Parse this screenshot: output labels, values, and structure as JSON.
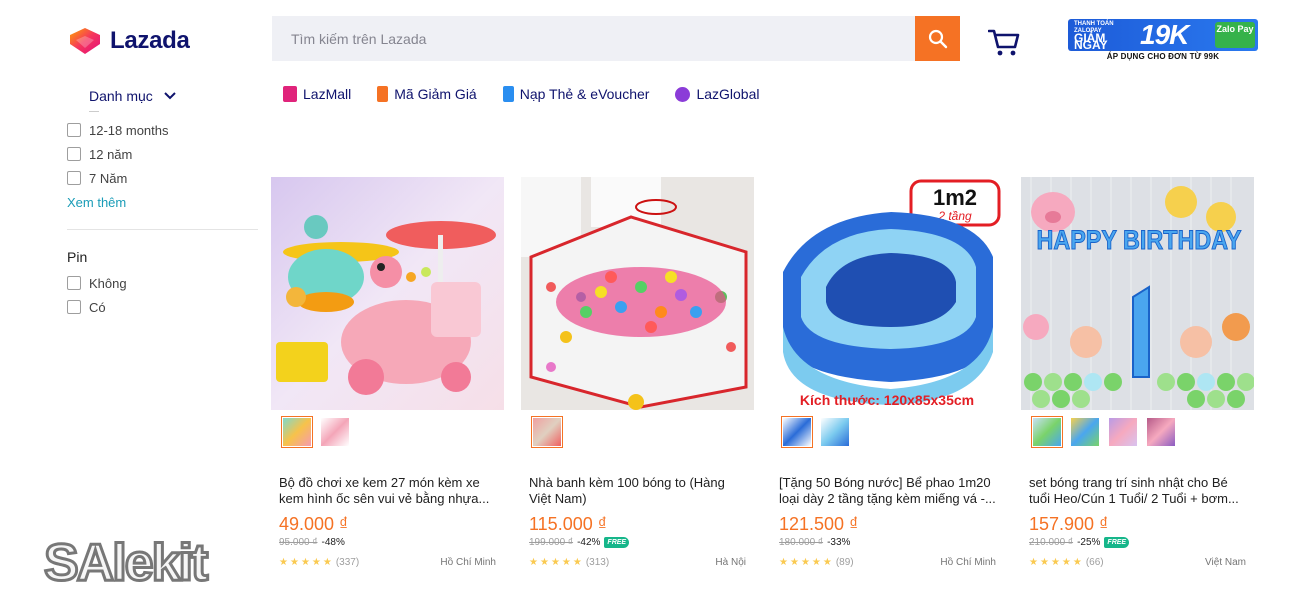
{
  "header": {
    "logo_text": "Lazada",
    "search_placeholder": "Tìm kiếm trên Lazada",
    "promo": {
      "line1": "THANH TOÁN ZALOPAY",
      "line2": "GIẢM NGAY",
      "amount": "19K",
      "badge": "Zalo Pay",
      "bottom": "ÁP DỤNG CHO ĐƠN TỪ 99K"
    }
  },
  "category_label": "Danh mục",
  "topnav": [
    {
      "label": "LazMall",
      "color": "#e0247b"
    },
    {
      "label": "Mã Giảm Giá",
      "color": "#f57224"
    },
    {
      "label": "Nạp Thẻ & eVoucher",
      "color": "#2a8ef0"
    },
    {
      "label": "LazGlobal",
      "color": "#8b3cd8"
    }
  ],
  "filters": {
    "age_options": [
      "12-18 months",
      "12 năm",
      "7 Năm"
    ],
    "see_more": "Xem thêm",
    "battery_title": "Pin",
    "battery_options": [
      "Không",
      "Có"
    ]
  },
  "products": [
    {
      "title": "Bộ đồ chơi xe kem 27 món kèm xe kem hình ốc sên vui vẻ bằng nhựa...",
      "price": "49.000 ₫",
      "original_price": "95.000 ₫",
      "discount": "-48%",
      "free_shipping": false,
      "rating_count": "(337)",
      "location": "Hồ Chí Minh"
    },
    {
      "title": "Nhà banh kèm 100 bóng to (Hàng Việt Nam)",
      "price": "115.000 ₫",
      "original_price": "199.000 ₫",
      "discount": "-42%",
      "free_shipping": true,
      "rating_count": "(313)",
      "location": "Hà Nội"
    },
    {
      "title": "[Tặng 50 Bóng nước] Bể phao 1m20 loại dày 2 tầng tặng kèm miếng vá -...",
      "price": "121.500 ₫",
      "original_price": "180.000 ₫",
      "discount": "-33%",
      "free_shipping": false,
      "rating_count": "(89)",
      "location": "Hồ Chí Minh",
      "image_text": {
        "badge_big": "1m2",
        "badge_small": "2 tầng",
        "size": "Kích thước: 120x85x35cm"
      }
    },
    {
      "title": "set bóng trang trí sinh nhật cho Bé tuổi Heo/Cún 1 Tuổi/ 2 Tuổi + bơm...",
      "price": "157.900 ₫",
      "original_price": "210.000 ₫",
      "discount": "-25%",
      "free_shipping": true,
      "rating_count": "(66)",
      "location": "Việt Nam",
      "image_text": {
        "banner": "HAPPY BIRTHDAY"
      }
    }
  ],
  "free_label": "FREE",
  "watermark": "SAlekit",
  "colors": {
    "accent": "#f57224",
    "navy": "#0f136d",
    "link": "#1a9cb7"
  }
}
